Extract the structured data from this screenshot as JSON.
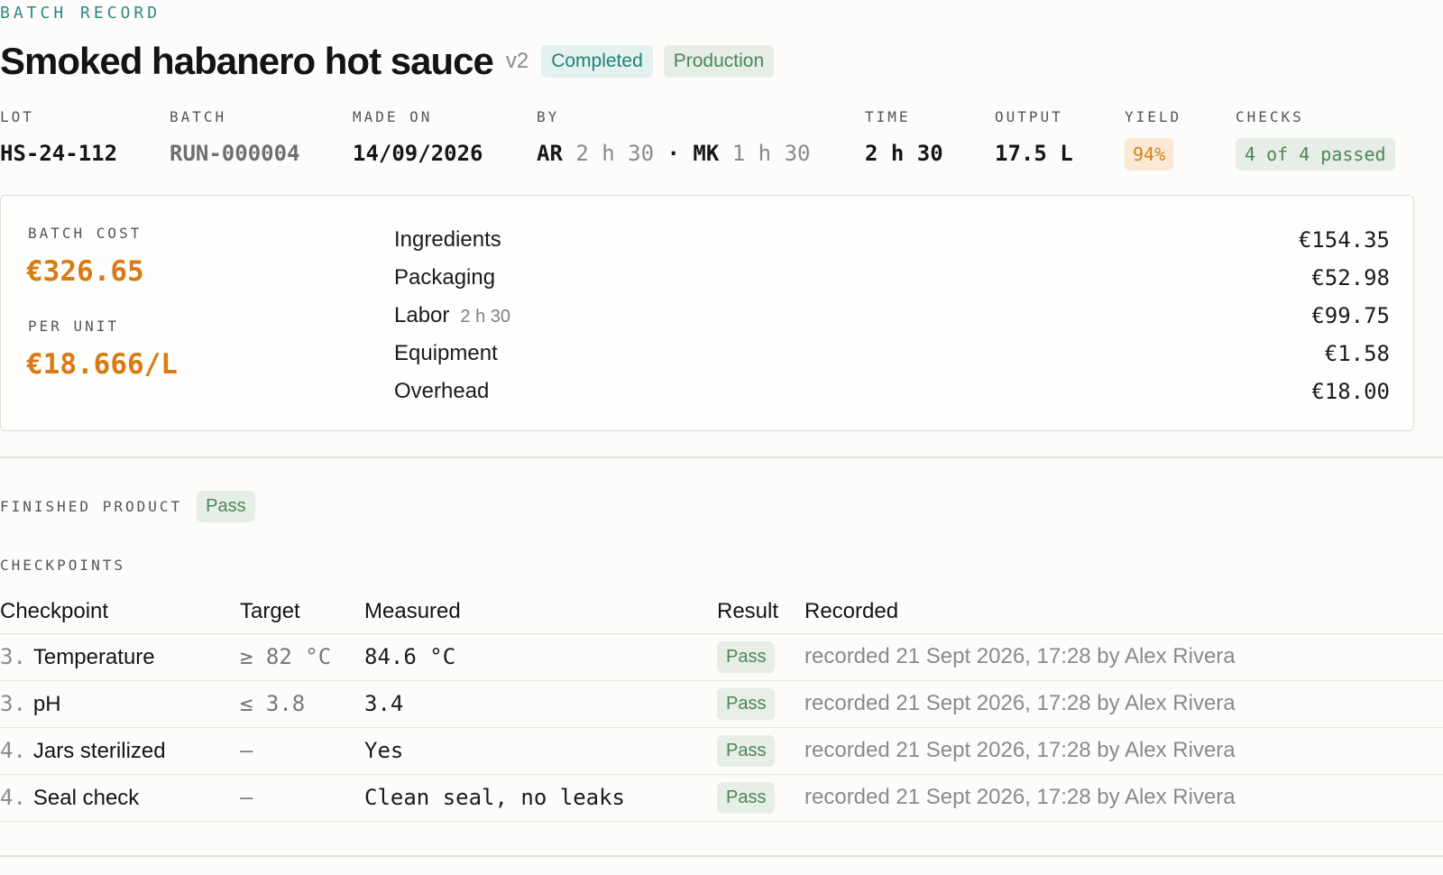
{
  "header": {
    "eyebrow": "BATCH RECORD",
    "title": "Smoked habanero hot sauce",
    "version": "v2",
    "status_badge": "Completed",
    "env_badge": "Production"
  },
  "meta": {
    "lot": {
      "label": "LOT",
      "value": "HS-24-112"
    },
    "batch": {
      "label": "BATCH",
      "value": "RUN-000004"
    },
    "made_on": {
      "label": "MADE ON",
      "value": "14/09/2026"
    },
    "by": {
      "label": "BY",
      "person1": "AR",
      "time1": "2 h 30",
      "separator": "·",
      "person2": "MK",
      "time2": "1 h 30"
    },
    "time": {
      "label": "TIME",
      "value": "2 h 30"
    },
    "output": {
      "label": "OUTPUT",
      "value": "17.5 L"
    },
    "yield": {
      "label": "YIELD",
      "value": "94%"
    },
    "checks": {
      "label": "CHECKS",
      "value": "4 of 4 passed"
    }
  },
  "cost": {
    "batch_cost_label": "BATCH COST",
    "batch_cost_value": "€326.65",
    "per_unit_label": "PER UNIT",
    "per_unit_value": "€18.666/L",
    "lines": [
      {
        "name": "Ingredients",
        "sub": "",
        "amount": "€154.35"
      },
      {
        "name": "Packaging",
        "sub": "",
        "amount": "€52.98"
      },
      {
        "name": "Labor",
        "sub": "2 h 30",
        "amount": "€99.75"
      },
      {
        "name": "Equipment",
        "sub": "",
        "amount": "€1.58"
      },
      {
        "name": "Overhead",
        "sub": "",
        "amount": "€18.00"
      }
    ]
  },
  "finished_product": {
    "label": "FINISHED PRODUCT",
    "status": "Pass"
  },
  "checkpoints": {
    "label": "CHECKPOINTS",
    "columns": [
      "Checkpoint",
      "Target",
      "Measured",
      "Result",
      "Recorded"
    ],
    "rows": [
      {
        "num": "3.",
        "name": "Temperature",
        "target": "≥ 82 °C",
        "measured": "84.6 °C",
        "result": "Pass",
        "recorded": "recorded 21 Sept 2026, 17:28 by Alex Rivera"
      },
      {
        "num": "3.",
        "name": "pH",
        "target": "≤ 3.8",
        "measured": "3.4",
        "result": "Pass",
        "recorded": "recorded 21 Sept 2026, 17:28 by Alex Rivera"
      },
      {
        "num": "4.",
        "name": "Jars sterilized",
        "target": "—",
        "measured": "Yes",
        "result": "Pass",
        "recorded": "recorded 21 Sept 2026, 17:28 by Alex Rivera"
      },
      {
        "num": "4.",
        "name": "Seal check",
        "target": "—",
        "measured": "Clean seal, no leaks",
        "result": "Pass",
        "recorded": "recorded 21 Sept 2026, 17:28 by Alex Rivera"
      }
    ]
  }
}
